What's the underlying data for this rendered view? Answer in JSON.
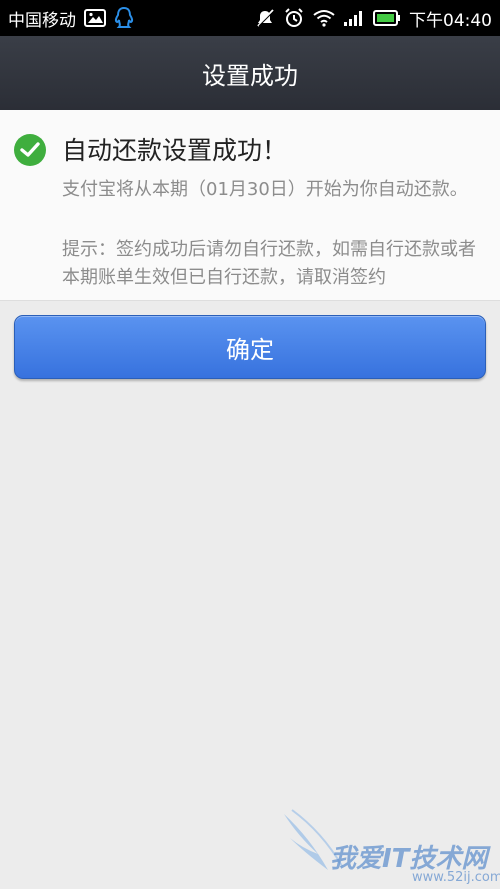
{
  "status_bar": {
    "carrier": "中国移动",
    "time": "下午04:40"
  },
  "header": {
    "title": "设置成功"
  },
  "result": {
    "title": "自动还款设置成功！",
    "description": "支付宝将从本期（01月30日）开始为你自动还款。",
    "tip": "提示：签约成功后请勿自行还款，如需自行还款或者本期账单生效但已自行还款，请取消签约"
  },
  "actions": {
    "confirm_label": "确定"
  },
  "watermark": {
    "text": "我爱IT技术网",
    "url": "www.52ij.com"
  },
  "colors": {
    "success": "#3fae3e",
    "button": "#4a84e8",
    "header": "#2f323a"
  }
}
